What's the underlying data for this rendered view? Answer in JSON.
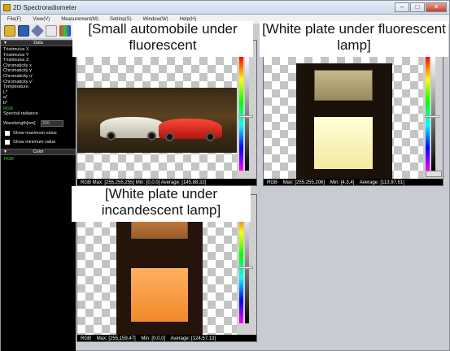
{
  "window": {
    "title": "2D Spectroradiometer",
    "buttons": {
      "minimize": "–",
      "maximize": "□",
      "close": "✕"
    }
  },
  "menu": [
    "File(F)",
    "View(V)",
    "Measurement(M)",
    "Setting(S)",
    "Window(W)",
    "Help(H)"
  ],
  "toolbar": {
    "icons": [
      "open-folder-icon",
      "save-icon",
      "measure-icon",
      "edit-icon",
      "palette-icon"
    ]
  },
  "left_panel": {
    "data_header": "Data",
    "items": [
      "Tristimulus X",
      "Tristimulus Y",
      "Tristimulus Z",
      "Chromaticity x",
      "Chromaticity y",
      "Chromaticity u'",
      "Chromaticity v'",
      "Temperature",
      "L*",
      "a*",
      "b*",
      "RGB",
      "Spectral radiance"
    ],
    "selected_item": "RGB",
    "wavelength_label": "Wavelength[nm]",
    "wavelength_value": "555",
    "show_max": "Show maximum value",
    "show_min": "Show minimum value",
    "color_header": "Color",
    "color_value": "RGB"
  },
  "views": {
    "car": {
      "status": "RGB  Max: [255,255,255] Min: [0,0,0] Average: [145,88,32]"
    },
    "fluorescent": {
      "status_label": "RGB",
      "max": "Max: [255,255,206]",
      "min": "Min: [4,3,4]",
      "avg": "Average: [113,97,51]"
    },
    "incandescent": {
      "status_label": "RGB",
      "max": "Max: [255,159,47]",
      "min": "Min: [0,0,0]",
      "avg": "Average: [124,57,13]"
    }
  },
  "captions": {
    "car": "[Small automobile under fluorescent",
    "fluorescent": "[White plate under fluorescent lamp]",
    "incandescent": "[White plate under incandescent lamp]"
  },
  "colors": {
    "accent_green": "#3ad23a",
    "panel_bg": "#000000",
    "mdi_bg": "#c8ccd2"
  }
}
